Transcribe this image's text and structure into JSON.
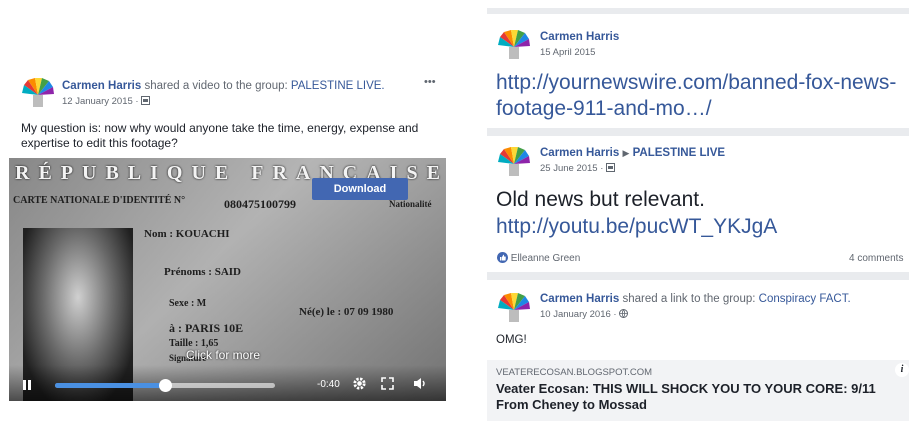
{
  "left_post": {
    "author": "Carmen Harris",
    "action": "shared a video to the group:",
    "group": "PALESTINE LIVE.",
    "date": "12 January 2015",
    "more": "•••",
    "text": "My question is: now why would anyone take the time, energy, expense and expertise to edit this footage?",
    "video": {
      "download_label": "Download",
      "overlay_text": "Click for more",
      "time": "-0:40",
      "progress": 0.5,
      "card_header": "RÉPUBLIQUE FRANÇAISE",
      "card_title": "CARTE NATIONALE D'IDENTITÉ N°",
      "card_number": "080475100799",
      "nationality": "Nationalité",
      "nom": "Nom : KOUACHI",
      "prenoms": "Prénoms : SAID",
      "sexe": "Sexe : M",
      "ne": "Né(e) le : 07 09 1980",
      "lieu": "à : PARIS 10E",
      "taille": "Taille : 1,65",
      "signature": "Signature"
    }
  },
  "right_post1": {
    "author": "Carmen Harris",
    "date": "15 April 2015",
    "link": "http://yournewswire.com/banned-fox-news-footage-911-and-mo…/"
  },
  "right_post2": {
    "author": "Carmen Harris",
    "arrow": "▶",
    "group": "PALESTINE LIVE",
    "date": "25 June 2015",
    "text": "Old news but relevant.",
    "link": "http://youtu.be/pucWT_YKJgA",
    "reactor": "Elleanne Green",
    "comments": "4 comments"
  },
  "right_post3": {
    "author": "Carmen Harris",
    "action": "shared a link to the group:",
    "group": "Conspiracy FACT.",
    "date": "10 January 2016",
    "text": "OMG!",
    "domain": "VEATERECOSAN.BLOGSPOT.COM",
    "title": "Veater Ecosan: THIS WILL SHOCK YOU TO YOUR CORE: 9/11 From Cheney to Mossad"
  },
  "colors": {
    "link": "#365899",
    "download": "#4267b2",
    "progress": "#4a90e2"
  }
}
